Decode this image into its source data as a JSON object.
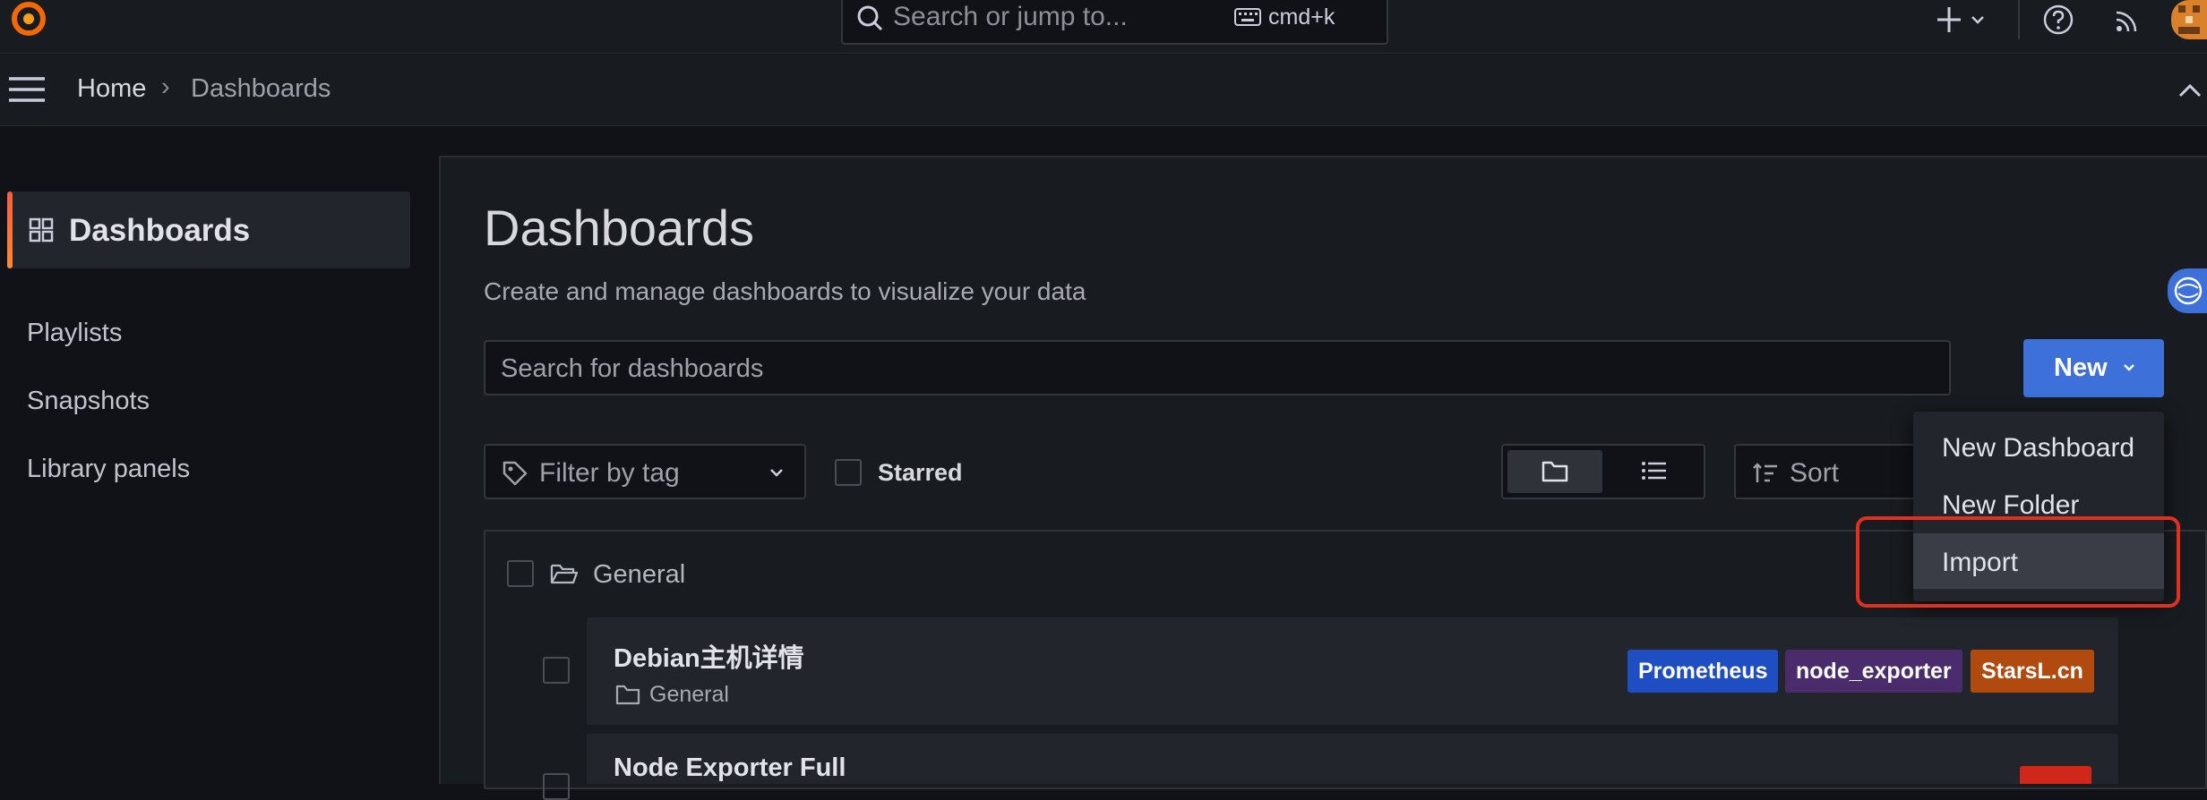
{
  "topbar": {
    "search_placeholder": "Search or jump to...",
    "shortcut": "cmd+k",
    "icons": [
      "grafana-logo-icon",
      "search-icon",
      "keyboard-icon",
      "plus-icon",
      "chevron-down-icon",
      "help-icon",
      "rss-icon",
      "avatar"
    ]
  },
  "breadcrumb": {
    "home": "Home",
    "separator": "›",
    "current": "Dashboards"
  },
  "sidebar": {
    "active": "Dashboards",
    "items": [
      "Playlists",
      "Snapshots",
      "Library panels"
    ]
  },
  "main": {
    "title": "Dashboards",
    "subtitle": "Create and manage dashboards to visualize your data",
    "search_placeholder": "Search for dashboards",
    "new_button": "New",
    "filter_placeholder": "Filter by tag",
    "starred_label": "Starred",
    "sort_label": "Sort"
  },
  "new_menu": {
    "items": [
      "New Dashboard",
      "New Folder",
      "Import"
    ],
    "highlighted": "Import"
  },
  "folders": [
    {
      "name": "General",
      "dashboards": [
        {
          "title": "Debian主机详情",
          "folder": "General",
          "tags": [
            {
              "label": "Prometheus",
              "color": "#1f4dc2"
            },
            {
              "label": "node_exporter",
              "color": "#4a2b6b"
            },
            {
              "label": "StarsL.cn",
              "color": "#b04a0e"
            }
          ]
        },
        {
          "title": "Node Exporter Full",
          "folder": "",
          "tags": []
        }
      ]
    }
  ],
  "colors": {
    "primary": "#3d71d9",
    "accent": "#ff8833",
    "highlight_box": "#e0301e",
    "background": "#111217",
    "panel": "#181b1f"
  }
}
